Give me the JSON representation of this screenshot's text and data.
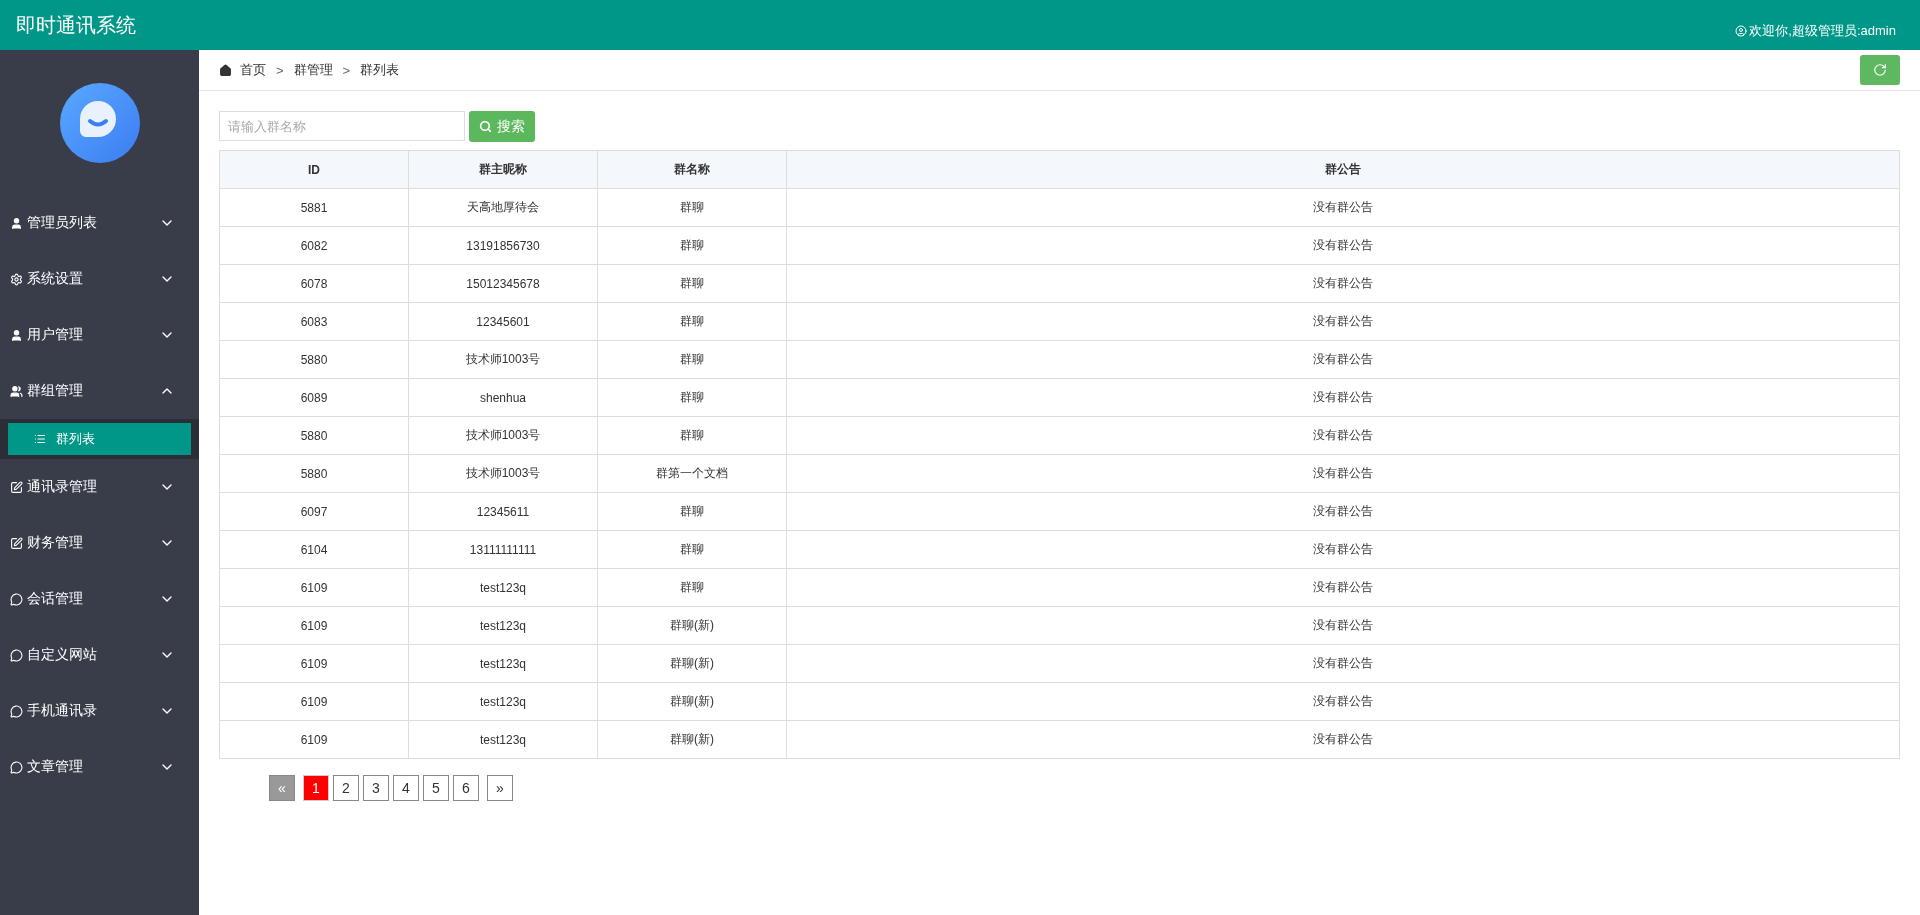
{
  "header": {
    "title": "即时通讯系统",
    "user": "欢迎你,超级管理员:admin"
  },
  "sidebar": {
    "items": [
      {
        "label": "管理员列表",
        "expanded": false
      },
      {
        "label": "系统设置",
        "expanded": false
      },
      {
        "label": "用户管理",
        "expanded": false
      },
      {
        "label": "群组管理",
        "expanded": true,
        "children": [
          {
            "label": "群列表",
            "selected": true
          }
        ]
      },
      {
        "label": "通讯录管理",
        "expanded": false
      },
      {
        "label": "财务管理",
        "expanded": false
      },
      {
        "label": "会话管理",
        "expanded": false
      },
      {
        "label": "自定义网站",
        "expanded": false
      },
      {
        "label": "手机通讯录",
        "expanded": false
      },
      {
        "label": "文章管理",
        "expanded": false
      }
    ]
  },
  "breadcrumb": [
    "首页",
    "群管理",
    "群列表"
  ],
  "breadcrumb_separator": ">",
  "search": {
    "placeholder": "请输入群名称",
    "button": "搜索"
  },
  "table": {
    "columns": [
      "ID",
      "群主昵称",
      "群名称",
      "群公告"
    ],
    "rows": [
      [
        "5881",
        "天高地厚待会",
        "群聊",
        "没有群公告"
      ],
      [
        "6082",
        "13191856730",
        "群聊",
        "没有群公告"
      ],
      [
        "6078",
        "15012345678",
        "群聊",
        "没有群公告"
      ],
      [
        "6083",
        "12345601",
        "群聊",
        "没有群公告"
      ],
      [
        "5880",
        "技术师1003号",
        "群聊",
        "没有群公告"
      ],
      [
        "6089",
        "shenhua",
        "群聊",
        "没有群公告"
      ],
      [
        "5880",
        "技术师1003号",
        "群聊",
        "没有群公告"
      ],
      [
        "5880",
        "技术师1003号",
        "群第一个文档",
        "没有群公告"
      ],
      [
        "6097",
        "12345611",
        "群聊",
        "没有群公告"
      ],
      [
        "6104",
        "13111111111",
        "群聊",
        "没有群公告"
      ],
      [
        "6109",
        "test123q",
        "群聊",
        "没有群公告"
      ],
      [
        "6109",
        "test123q",
        "群聊(新)",
        "没有群公告"
      ],
      [
        "6109",
        "test123q",
        "群聊(新)",
        "没有群公告"
      ],
      [
        "6109",
        "test123q",
        "群聊(新)",
        "没有群公告"
      ],
      [
        "6109",
        "test123q",
        "群聊(新)",
        "没有群公告"
      ]
    ]
  },
  "pagination": {
    "prev": {
      "label": "«",
      "disabled": true
    },
    "pages": [
      {
        "label": "1",
        "selected": true
      },
      {
        "label": "2",
        "selected": false
      },
      {
        "label": "3",
        "selected": false
      },
      {
        "label": "4",
        "selected": false
      },
      {
        "label": "5",
        "selected": false
      },
      {
        "label": "6",
        "selected": false
      }
    ],
    "next": {
      "label": "»",
      "disabled": false
    }
  }
}
